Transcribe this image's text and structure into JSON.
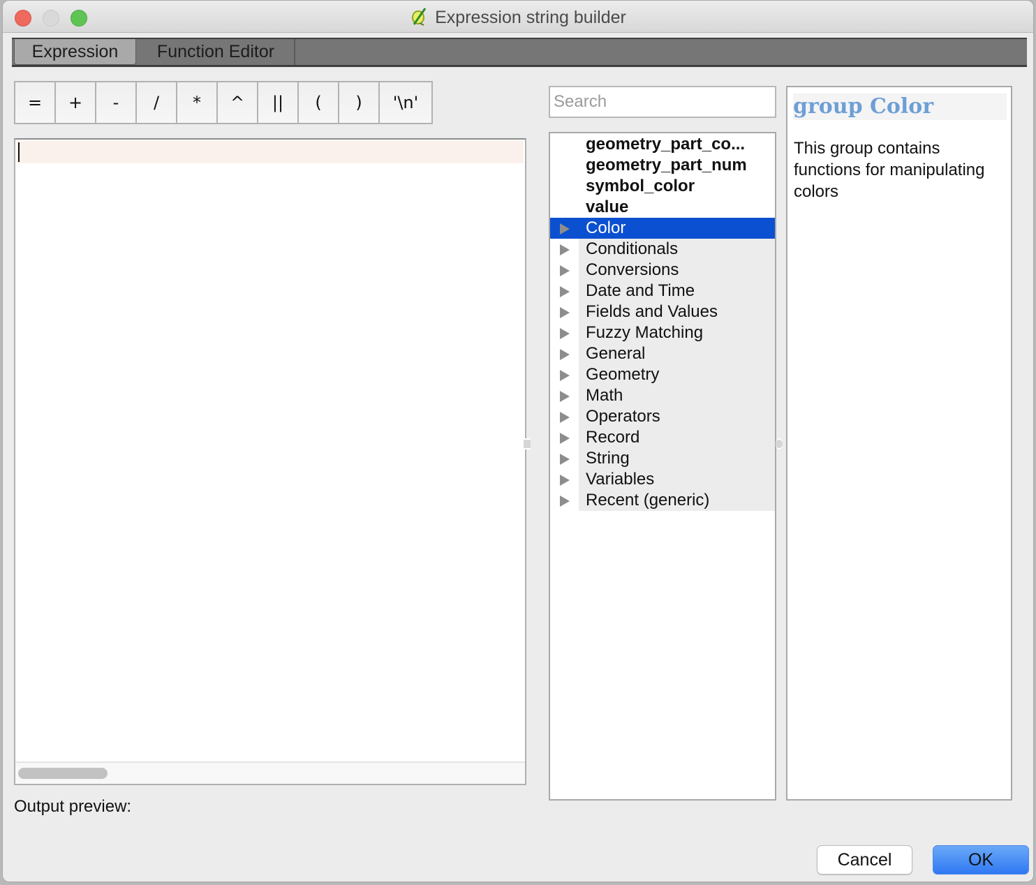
{
  "window": {
    "title": "Expression string builder",
    "app_icon": "qgis-icon"
  },
  "tabs": [
    {
      "label": "Expression",
      "active": true
    },
    {
      "label": "Function Editor",
      "active": false
    }
  ],
  "operators": [
    "=",
    "+",
    "-",
    "/",
    "*",
    "^",
    "||",
    "(",
    ")",
    "'\\n'"
  ],
  "editor": {
    "value": ""
  },
  "output_preview_label": "Output preview:",
  "search": {
    "placeholder": "Search",
    "value": ""
  },
  "tree": {
    "variables": [
      "geometry_part_co...",
      "geometry_part_num",
      "symbol_color",
      "value"
    ],
    "groups": [
      "Color",
      "Conditionals",
      "Conversions",
      "Date and Time",
      "Fields and Values",
      "Fuzzy Matching",
      "General",
      "Geometry",
      "Math",
      "Operators",
      "Record",
      "String",
      "Variables",
      "Recent (generic)"
    ],
    "selected": "Color"
  },
  "help": {
    "title": "group Color",
    "body": "This group contains functions for manipulating colors"
  },
  "buttons": {
    "cancel": "Cancel",
    "ok": "OK"
  },
  "colors": {
    "selection": "#0b50d0",
    "help_title": "#6d9fd6",
    "ok_button": "#3d82f5"
  }
}
